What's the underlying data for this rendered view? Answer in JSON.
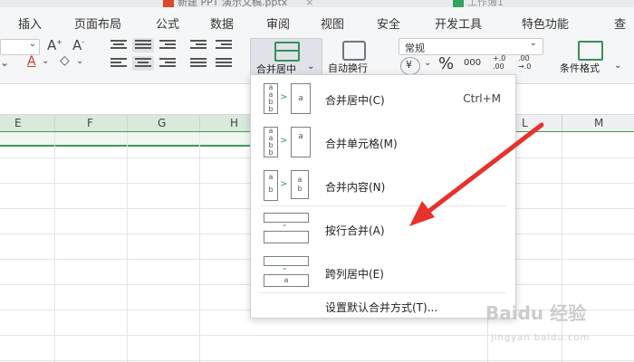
{
  "tabs": {
    "doc1": "新建 PPT 演示文稿.pptx",
    "doc2": "工作簿1"
  },
  "menubar": [
    "插入",
    "页面布局",
    "公式",
    "数据",
    "审阅",
    "视图",
    "安全",
    "开发工具",
    "特色功能",
    "查"
  ],
  "ribbon": {
    "merge_center": "合并居中",
    "wrap_text": "自动换行",
    "number_format": "常规",
    "cond_format": "条件格式",
    "currency_symbol": "¥",
    "percent_symbol": "%",
    "thousands": "000",
    "dec_inc": "+.0\n.00",
    "dec_dec": ".00\n→.0"
  },
  "columns": [
    "E",
    "F",
    "G",
    "H",
    "L",
    "M"
  ],
  "merge_menu": {
    "items": [
      {
        "label": "合并居中(C)",
        "shortcut": "Ctrl+M"
      },
      {
        "label": "合并单元格(M)",
        "shortcut": ""
      },
      {
        "label": "合并内容(N)",
        "shortcut": ""
      },
      {
        "label": "按行合并(A)",
        "shortcut": ""
      },
      {
        "label": "跨列居中(E)",
        "shortcut": ""
      },
      {
        "label": "设置默认合并方式(T)...",
        "shortcut": ""
      }
    ]
  },
  "annotation": {
    "color": "#e8322d"
  },
  "watermark": {
    "brand": "Baidu 经验",
    "url": "jingyan.baidu.com"
  },
  "colors": {
    "accent_green": "#3f9a53",
    "arrow_red": "#e8322d"
  }
}
